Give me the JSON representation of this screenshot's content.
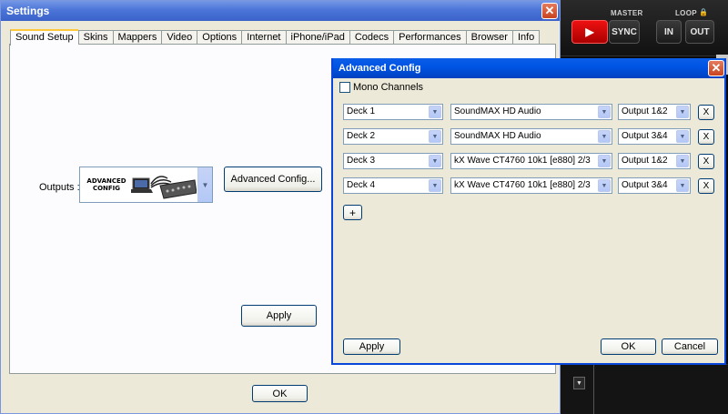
{
  "dj": {
    "master_label": "MASTER",
    "loop_label": "LOOP",
    "lock_icon": "lock-icon",
    "play_symbol": "▶",
    "sync_label": "SYNC",
    "in_label": "IN",
    "out_label": "OUT",
    "play_color": "#dd1111"
  },
  "settings": {
    "title": "Settings",
    "close_symbol": "✕",
    "tabs": [
      "Sound Setup",
      "Skins",
      "Mappers",
      "Video",
      "Options",
      "Internet",
      "iPhone/iPad",
      "Codecs",
      "Performances",
      "Browser",
      "Info"
    ],
    "active_tab": "Sound Setup",
    "outputs_label": "Outputs :",
    "outputs_image_text": "ADVANCED CONFIG",
    "advanced_config_button": "Advanced Config...",
    "apply_label": "Apply",
    "ok_label": "OK"
  },
  "advanced": {
    "title": "Advanced Config",
    "close_symbol": "✕",
    "mono_label": "Mono Channels",
    "mono_checked": false,
    "rows": [
      {
        "deck": "Deck 1",
        "device": "SoundMAX HD Audio",
        "output": "Output 1&2",
        "remove": "X"
      },
      {
        "deck": "Deck 2",
        "device": "SoundMAX HD Audio",
        "output": "Output 3&4",
        "remove": "X"
      },
      {
        "deck": "Deck 3",
        "device": "kX Wave CT4760 10k1 [e880] 2/3",
        "output": "Output 1&2",
        "remove": "X"
      },
      {
        "deck": "Deck 4",
        "device": "kX Wave CT4760 10k1 [e880] 2/3",
        "output": "Output 3&4",
        "remove": "X"
      }
    ],
    "add_label": "+",
    "apply_label": "Apply",
    "ok_label": "OK",
    "cancel_label": "Cancel"
  }
}
